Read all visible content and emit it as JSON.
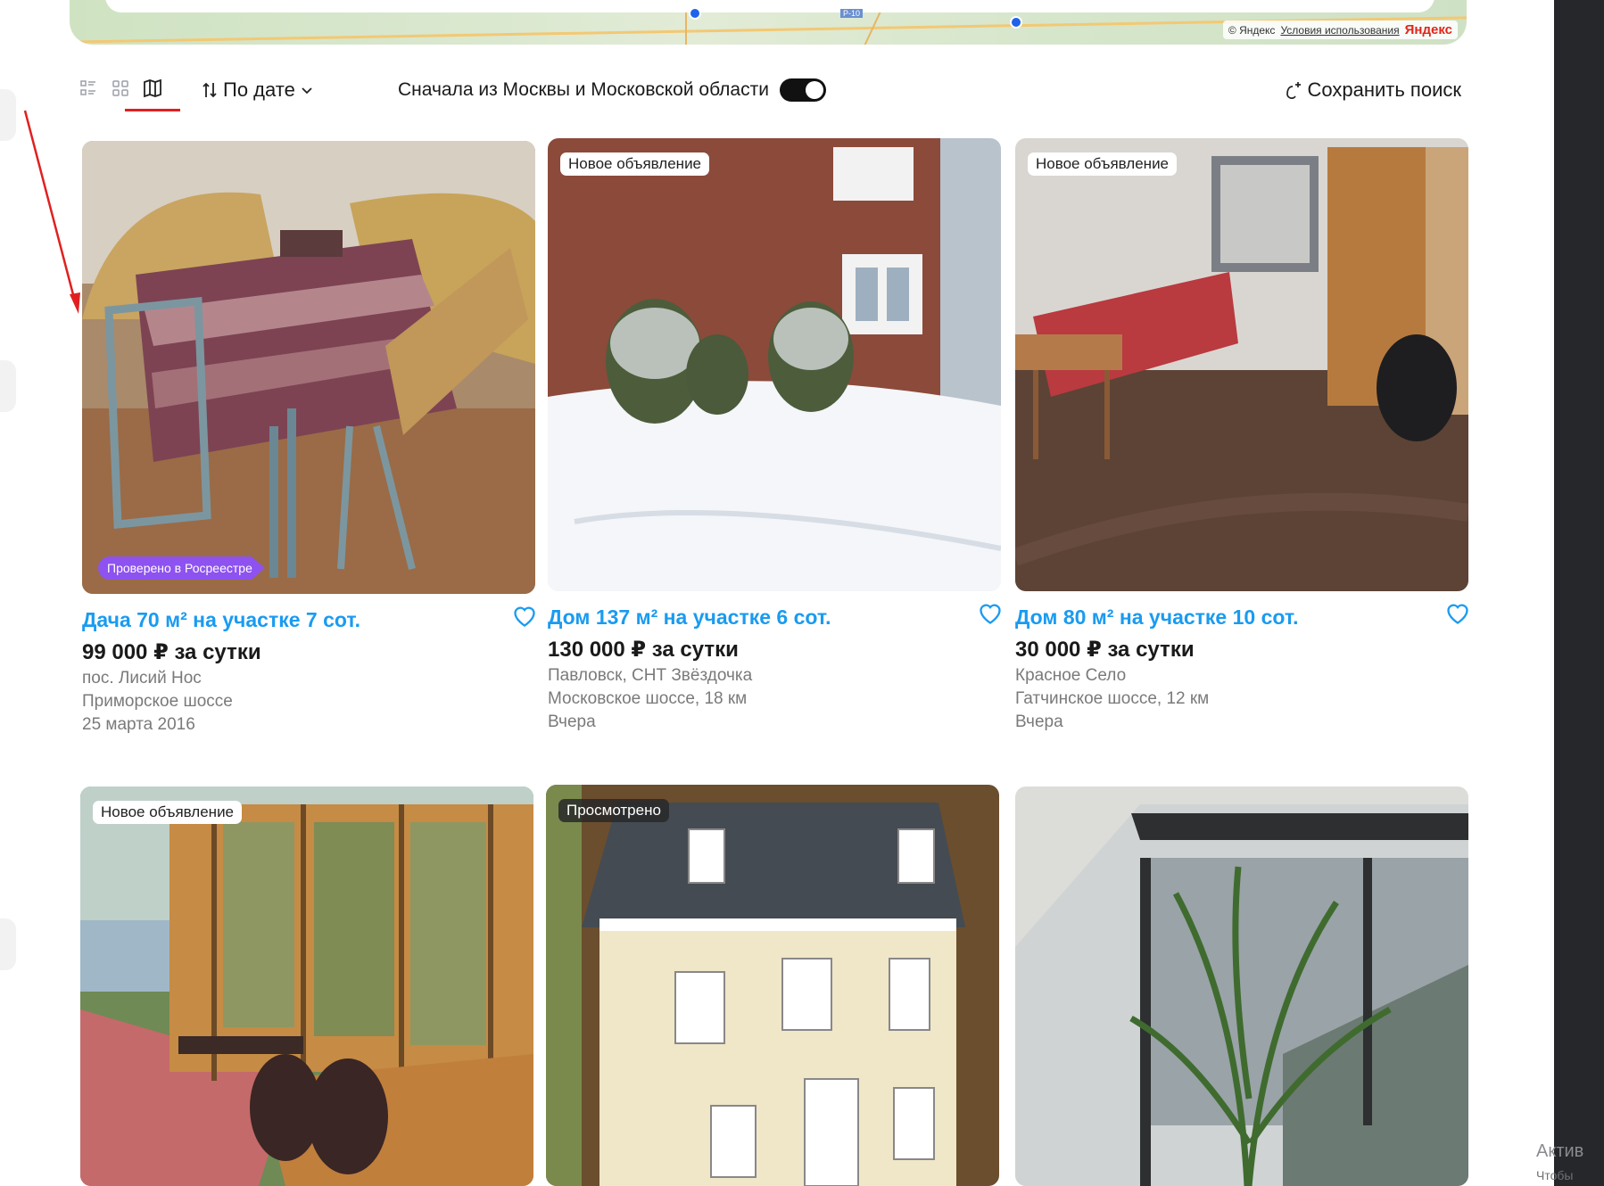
{
  "map": {
    "copyright": "© Яндекс",
    "terms": "Условия использования",
    "brand": "Яндекс",
    "route_label": "Р-10"
  },
  "toolbar": {
    "sort_label": "По дате",
    "moscow_filter_label": "Сначала из Москвы и Московской области",
    "moscow_filter_on": true,
    "save_search_label": "Сохранить поиск"
  },
  "listings": [
    {
      "badge": "",
      "verified_badge": "Проверено в Росреестре",
      "title": "Дача 70 м² на участке 7 сот.",
      "price": "99 000 ₽ за сутки",
      "location": "пос. Лисий Нос",
      "highway": "Приморское шоссе",
      "date": "25 марта 2016"
    },
    {
      "badge": "Новое объявление",
      "title": "Дом 137 м² на участке 6 сот.",
      "price": "130 000 ₽ за сутки",
      "location": "Павловск, СНТ Звёздочка",
      "highway": "Московское шоссе, 18 км",
      "date": "Вчера"
    },
    {
      "badge": "Новое объявление",
      "title": "Дом 80 м² на участке 10 сот.",
      "price": "30 000 ₽ за сутки",
      "location": "Красное Село",
      "highway": "Гатчинское шоссе, 12 км",
      "date": "Вчера"
    },
    {
      "badge": "Новое объявление"
    },
    {
      "badge": "Просмотрено"
    },
    {
      "badge": ""
    }
  ],
  "os_overlay": {
    "activate": "Актив",
    "hint": "Чтобы"
  },
  "colors": {
    "title_link": "#1a9bf0",
    "verified_badge": "#8d52f0",
    "annotation_red": "#e02020",
    "dark_panel": "#26272a"
  }
}
